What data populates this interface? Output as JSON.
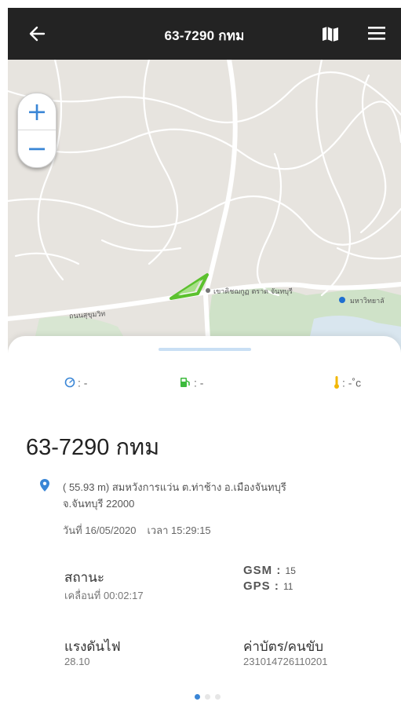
{
  "header": {
    "title": "63-7290 กทม",
    "back_icon": "arrow-left-icon",
    "map_icon": "map-icon",
    "menu_icon": "hamburger-menu-icon",
    "background": "#232323"
  },
  "map": {
    "zoom_in": "+",
    "zoom_out": "−",
    "labels": {
      "road": "ถนนสุขุมวิท",
      "place": "เขาคิชฌกูฏ ตราด จันทบุรี",
      "poi": "มหาวิทยาลั"
    },
    "vehicle_marker_color": "#5cc12e",
    "poi_pin_color": "#1f6fd1"
  },
  "sheet": {
    "stats": {
      "speed": ": -",
      "fuel": ": -",
      "temperature": ": -˚c"
    },
    "plate": "63-7290 กทม",
    "address_line1": "( 55.93 m) สมหวังการแว่น ต.ท่าช้าง อ.เมืองจันทบุรี",
    "address_line2": "จ.จันทบุรี 22000",
    "date_label": "วันที่ 16/05/2020",
    "time_label": "เวลา 15:29:15",
    "status_label": "สถานะ",
    "status_value": "เคลื่อนที่ 00:02:17",
    "gsm_label": "GSM :",
    "gsm_value": "15",
    "gps_label": "GPS :",
    "gps_value": "11",
    "voltage_label": "แรงดันไฟ",
    "voltage_value": "28.10",
    "card_label": "ค่าบัตร/คนขับ",
    "card_value": "231014726110201",
    "pager": {
      "count": 3,
      "active": 1
    }
  },
  "colors": {
    "accent_blue": "#3a86d6",
    "fuel_green": "#3cba3c",
    "temp_yellow": "#f2b705"
  }
}
